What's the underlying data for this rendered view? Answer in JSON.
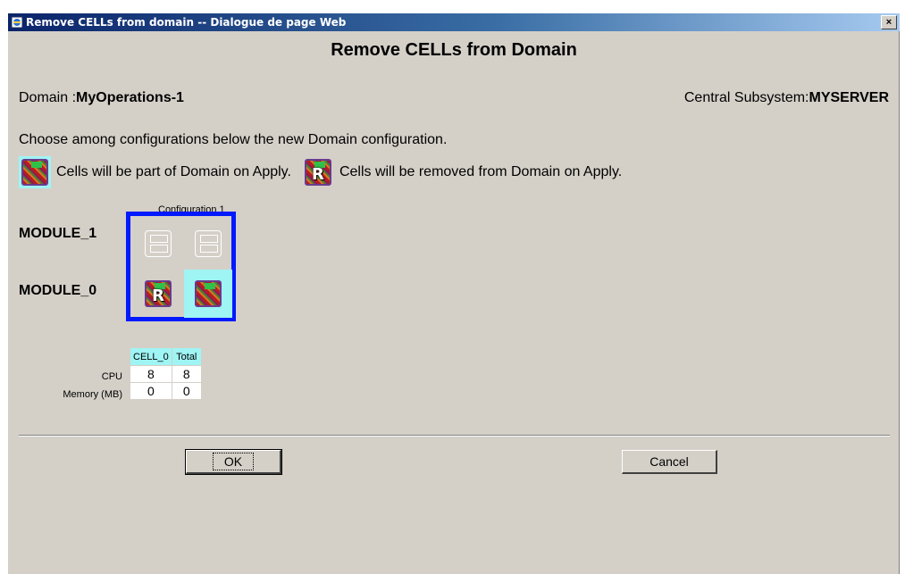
{
  "window": {
    "title": "Remove CELLs from domain -- Dialogue de page Web",
    "close_label": "×"
  },
  "heading": "Remove CELLs from Domain",
  "domain": {
    "label": "Domain :",
    "value": "MyOperations-1"
  },
  "subsystem": {
    "label": "Central Subsystem:",
    "value": "MYSERVER"
  },
  "instruction": "Choose among configurations below the new Domain configuration.",
  "legend": {
    "keep_text": "Cells will be part of Domain on Apply.",
    "remove_text": "Cells will be removed from Domain on Apply.",
    "remove_marker": "R"
  },
  "configuration": {
    "label": "Configuration 1",
    "modules": [
      {
        "name": "MODULE_1",
        "slots": [
          "empty",
          "empty"
        ]
      },
      {
        "name": "MODULE_0",
        "slots": [
          "remove",
          "keep"
        ]
      }
    ]
  },
  "resources": {
    "headers": [
      "CELL_0",
      "Total"
    ],
    "rows": [
      {
        "label": "CPU",
        "values": [
          "8",
          "8"
        ]
      },
      {
        "label": "Memory (MB)",
        "values": [
          "0",
          "0"
        ]
      }
    ]
  },
  "buttons": {
    "ok": "OK",
    "cancel": "Cancel"
  },
  "colors": {
    "config_border": "#0019ff",
    "selected_slot": "#9ff4f4",
    "title_bar": "#0a246a",
    "dialog_bg": "#d4d0c8"
  }
}
